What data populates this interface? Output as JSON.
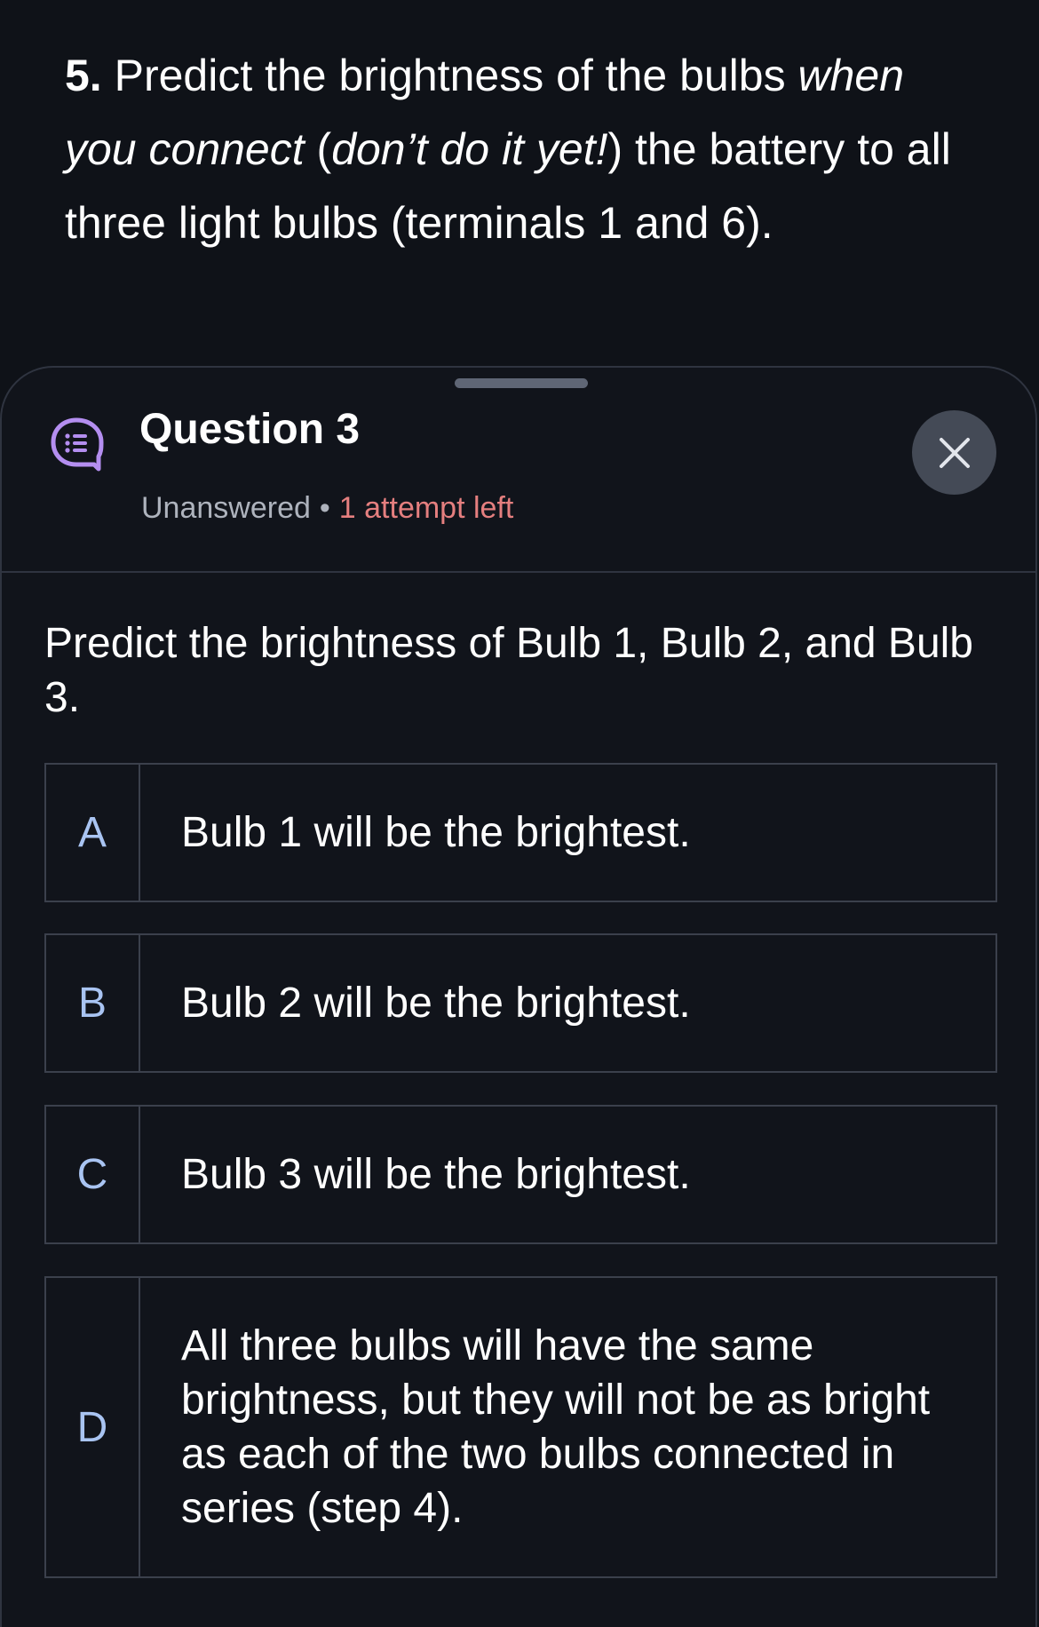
{
  "instruction": {
    "number": "5.",
    "part1": " Predict the brightness of the bulbs ",
    "italic1": "when you connect",
    "part2": " (",
    "italic2": "don’t do it yet!",
    "part3": ") the battery to all three light bulbs (terminals 1 and 6)."
  },
  "sheet": {
    "title": "Question 3",
    "status": "Unanswered",
    "separator": "•",
    "attempts": "1 attempt left",
    "prompt": "Predict the brightness of Bulb 1, Bulb 2, and Bulb 3.",
    "icons": {
      "question": "question-list-icon",
      "close": "close-icon"
    },
    "colors": {
      "icon_accent": "#b48ef0",
      "attempts": "#e57f7f",
      "option_letter": "#a9c4f2"
    }
  },
  "options": [
    {
      "letter": "A",
      "text": "Bulb 1 will be the brightest."
    },
    {
      "letter": "B",
      "text": "Bulb 2 will be the brightest."
    },
    {
      "letter": "C",
      "text": "Bulb 3 will be the brightest."
    },
    {
      "letter": "D",
      "text": "All three bulbs will have the same brightness, but they will not be as bright as each of the two bulbs connected in series (step 4)."
    }
  ]
}
